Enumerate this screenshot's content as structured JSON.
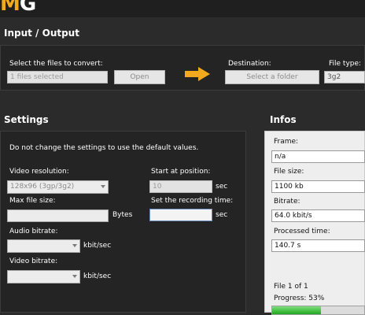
{
  "app": {
    "logo": {
      "letter1": "M",
      "letter2": "G"
    }
  },
  "io": {
    "title": "Input / Output",
    "select_files_label": "Select the files to convert:",
    "files_value": "1 files selected",
    "open_label": "Open",
    "destination_label": "Destination:",
    "select_folder_label": "Select a folder",
    "file_type_label": "File type:",
    "file_type_value": "3g2"
  },
  "settings": {
    "title": "Settings",
    "notice": "Do not change the settings to use the default values.",
    "video_resolution_label": "Video resolution:",
    "video_resolution_value": "128x96 (3gp/3g2)",
    "max_file_size_label": "Max file size:",
    "max_file_size_value": "",
    "bytes_label": "Bytes",
    "audio_bitrate_label": "Audio bitrate:",
    "audio_bitrate_value": "",
    "kbits_label": "kbit/sec",
    "video_bitrate_label": "Video bitrate:",
    "video_bitrate_value": "",
    "start_position_label": "Start at position:",
    "start_position_value": "10",
    "sec_label": "sec",
    "recording_time_label": "Set the recording time:",
    "recording_time_value": ""
  },
  "infos": {
    "title": "Infos",
    "frame_label": "Frame:",
    "frame_value": "n/a",
    "file_size_label": "File size:",
    "file_size_value": "1100 kb",
    "bitrate_label": "Bitrate:",
    "bitrate_value": "64.0 kbit/s",
    "processed_time_label": "Processed time:",
    "processed_time_value": "140.7 s",
    "file_count_text": "File 1 of 1",
    "progress_text": "Progress: 53%",
    "progress_percent": 53
  },
  "colors": {
    "accent": "#f2a91c",
    "progress": "#2db52d"
  },
  "icons": {
    "arrow": "arrow-right-icon"
  }
}
